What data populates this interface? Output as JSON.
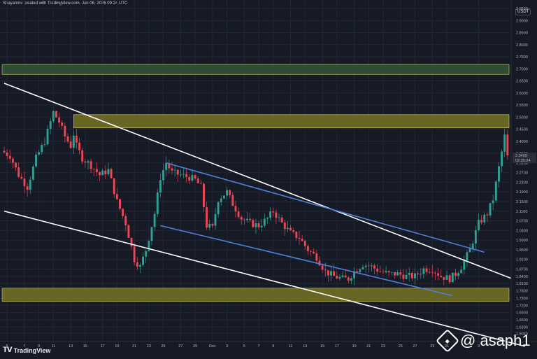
{
  "credit": "Shayanmv created with TradingView.com, Jan 06, 2026 09:24 UTC",
  "brand": "TradingView",
  "watermark": "@ asaph1",
  "chart_data": {
    "type": "candlestick",
    "unit": "USDT",
    "ylim": [
      1.57,
      2.985
    ],
    "yticks": [
      "2.9500",
      "2.9000",
      "2.8500",
      "2.8000",
      "2.7500",
      "2.7000",
      "2.6500",
      "2.6000",
      "2.5500",
      "2.5000",
      "2.4500",
      "2.4000",
      "2.3500",
      "2.3100",
      "2.2700",
      "2.2300",
      "2.1900",
      "2.1500",
      "2.1100",
      "2.0700",
      "2.0300",
      "1.9900",
      "1.9500",
      "1.9100",
      "1.8700",
      "1.8400",
      "1.8100",
      "1.7800",
      "1.7500",
      "1.7200",
      "1.6900",
      "1.6600",
      "1.6300",
      "1.6040"
    ],
    "xticks": [
      {
        "label": "5",
        "i": 1
      },
      {
        "label": "7",
        "i": 7
      },
      {
        "label": "9",
        "i": 12
      },
      {
        "label": "11",
        "i": 17
      },
      {
        "label": "13",
        "i": 23
      },
      {
        "label": "15",
        "i": 28
      },
      {
        "label": "17",
        "i": 34
      },
      {
        "label": "19",
        "i": 39
      },
      {
        "label": "21",
        "i": 45
      },
      {
        "label": "23",
        "i": 50
      },
      {
        "label": "25",
        "i": 55
      },
      {
        "label": "27",
        "i": 61
      },
      {
        "label": "29",
        "i": 66
      },
      {
        "label": "Dec",
        "i": 72
      },
      {
        "label": "3",
        "i": 77
      },
      {
        "label": "5",
        "i": 83
      },
      {
        "label": "7",
        "i": 88
      },
      {
        "label": "9",
        "i": 93
      },
      {
        "label": "11",
        "i": 99
      },
      {
        "label": "13",
        "i": 104
      },
      {
        "label": "15",
        "i": 110
      },
      {
        "label": "17",
        "i": 115
      },
      {
        "label": "19",
        "i": 121
      },
      {
        "label": "21",
        "i": 126
      },
      {
        "label": "23",
        "i": 131
      },
      {
        "label": "25",
        "i": 137
      },
      {
        "label": "27",
        "i": 142
      },
      {
        "label": "29",
        "i": 148
      },
      {
        "label": "31",
        "i": 153
      },
      {
        "label": "3",
        "i": 164
      }
    ],
    "candle_count": 175,
    "anchors": [
      [
        0,
        2.36
      ],
      [
        3,
        2.34
      ],
      [
        6,
        2.26
      ],
      [
        9,
        2.21
      ],
      [
        12,
        2.33
      ],
      [
        15,
        2.4
      ],
      [
        18,
        2.52
      ],
      [
        20,
        2.48
      ],
      [
        22,
        2.42
      ],
      [
        24,
        2.38
      ],
      [
        25,
        2.43
      ],
      [
        26,
        2.38
      ],
      [
        28,
        2.33
      ],
      [
        31,
        2.3
      ],
      [
        34,
        2.26
      ],
      [
        37,
        2.28
      ],
      [
        40,
        2.15
      ],
      [
        43,
        2.06
      ],
      [
        46,
        1.91
      ],
      [
        48,
        1.88
      ],
      [
        50,
        1.95
      ],
      [
        53,
        2.1
      ],
      [
        55,
        2.25
      ],
      [
        57,
        2.31
      ],
      [
        59,
        2.27
      ],
      [
        62,
        2.26
      ],
      [
        65,
        2.25
      ],
      [
        67,
        2.24
      ],
      [
        69,
        2.21
      ],
      [
        71,
        2.05
      ],
      [
        73,
        2.04
      ],
      [
        75,
        2.16
      ],
      [
        78,
        2.19
      ],
      [
        80,
        2.14
      ],
      [
        83,
        2.08
      ],
      [
        86,
        2.06
      ],
      [
        89,
        2.05
      ],
      [
        92,
        2.08
      ],
      [
        94,
        2.11
      ],
      [
        97,
        2.06
      ],
      [
        100,
        2.02
      ],
      [
        103,
        2.0
      ],
      [
        106,
        1.95
      ],
      [
        109,
        1.92
      ],
      [
        112,
        1.86
      ],
      [
        115,
        1.84
      ],
      [
        118,
        1.83
      ],
      [
        120,
        1.83
      ],
      [
        122,
        1.86
      ],
      [
        125,
        1.89
      ],
      [
        128,
        1.88
      ],
      [
        131,
        1.86
      ],
      [
        134,
        1.85
      ],
      [
        137,
        1.85
      ],
      [
        140,
        1.84
      ],
      [
        143,
        1.84
      ],
      [
        146,
        1.87
      ],
      [
        149,
        1.87
      ],
      [
        152,
        1.84
      ],
      [
        155,
        1.83
      ],
      [
        157,
        1.85
      ],
      [
        159,
        1.88
      ],
      [
        162,
        1.95
      ],
      [
        165,
        2.06
      ],
      [
        168,
        2.1
      ],
      [
        170,
        2.16
      ],
      [
        172,
        2.29
      ],
      [
        174,
        2.42
      ]
    ],
    "last_close": 2.3409,
    "last_price_label": "2.3409",
    "countdown_label": "02:35:24",
    "price_labels_note": "",
    "zones": [
      {
        "name": "resistance-upper",
        "from": 2.677,
        "to": 2.718,
        "color": "#2e5035"
      },
      {
        "name": "resistance",
        "from": 2.455,
        "to": 2.51,
        "color": "#6b6a24"
      },
      {
        "name": "support",
        "from": 1.736,
        "to": 1.791,
        "color": "#6b6a24"
      }
    ],
    "lines": [
      {
        "name": "descending-channel-top",
        "color": "#ffffff",
        "from": [
          0,
          2.64
        ],
        "to": [
          180,
          1.81
        ]
      },
      {
        "name": "descending-channel-bottom",
        "color": "#ffffff",
        "from": [
          0,
          2.11
        ],
        "to": [
          180,
          1.55
        ]
      },
      {
        "name": "wedge-top",
        "color": "#4f7fd6",
        "from": [
          56,
          2.31
        ],
        "to": [
          166,
          1.94
        ]
      },
      {
        "name": "wedge-bottom",
        "color": "#4f7fd6",
        "from": [
          54,
          2.05
        ],
        "to": [
          155,
          1.76
        ]
      }
    ],
    "colors": {
      "up": "#2fa193",
      "down": "#ee4655",
      "bg": "#161a25",
      "grid": "#22263a"
    },
    "grid": true
  }
}
